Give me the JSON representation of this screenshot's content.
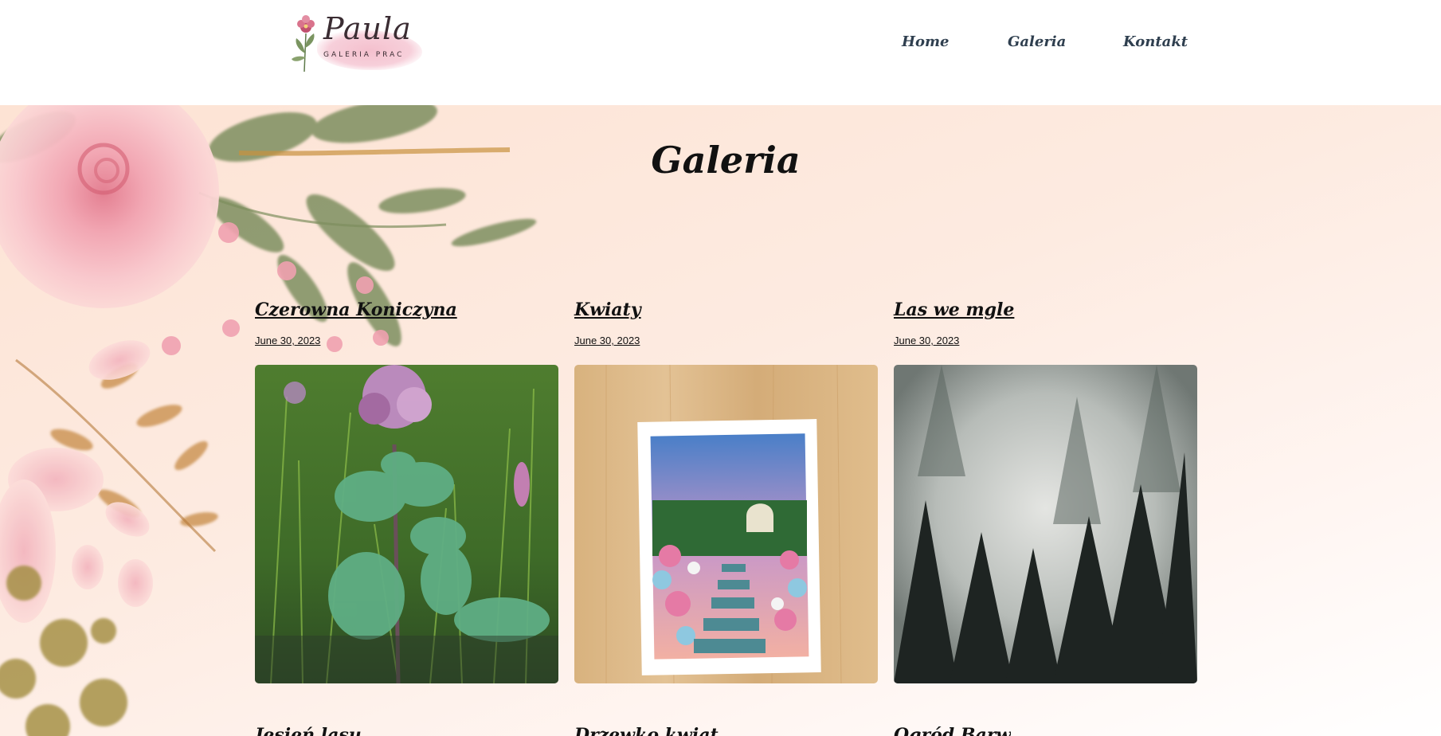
{
  "header": {
    "logo": {
      "script": "Paula",
      "subtitle": "GALERIA PRAC",
      "wash_color": "#f3b9c8"
    },
    "nav": [
      {
        "label": "Home"
      },
      {
        "label": "Galeria"
      },
      {
        "label": "Kontakt"
      }
    ]
  },
  "main": {
    "title": "Galeria",
    "posts": [
      {
        "title": "Czerowna Koniczyna",
        "date": "June 30, 2023",
        "image_icon": "clover-painting"
      },
      {
        "title": "Kwiaty",
        "date": "June 30, 2023",
        "image_icon": "flower-garden-painting"
      },
      {
        "title": "Las we mgle",
        "date": "June 30, 2023",
        "image_icon": "misty-forest-painting"
      }
    ],
    "next_row_titles": [
      "Jesień lasu",
      "Drzewko kwiat",
      "Ogród Barw"
    ]
  },
  "colors": {
    "background_peach": "#fde3d4",
    "nav_text": "#2f3f4f",
    "title_text": "#111111"
  }
}
